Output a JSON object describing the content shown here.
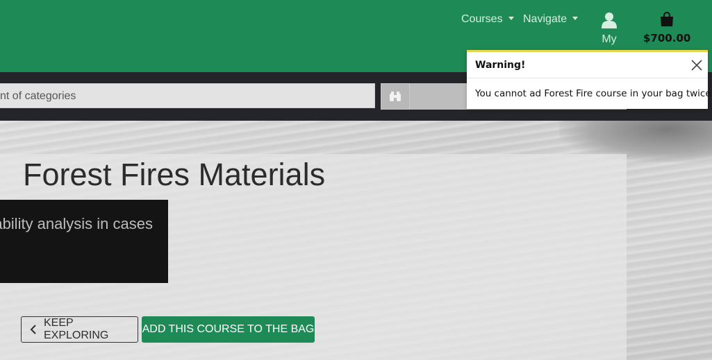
{
  "nav": {
    "courses_label": "Courses",
    "navigate_label": "Navigate",
    "my_label": "My",
    "bag_total": "$700.00"
  },
  "search": {
    "value": "nt of categories"
  },
  "hero": {
    "title": "Forest Fires Materials",
    "subtitle": "ability analysis in cases"
  },
  "actions": {
    "keep_exploring": "KEEP EXPLORING",
    "add_course": "ADD THIS COURSE TO THE BAG"
  },
  "toast": {
    "title": "Warning!",
    "message": "You cannot ad Forest Fire course in your bag twice."
  },
  "colors": {
    "brand_green": "#1e8a55",
    "warning_accent": "#e8d64a"
  }
}
